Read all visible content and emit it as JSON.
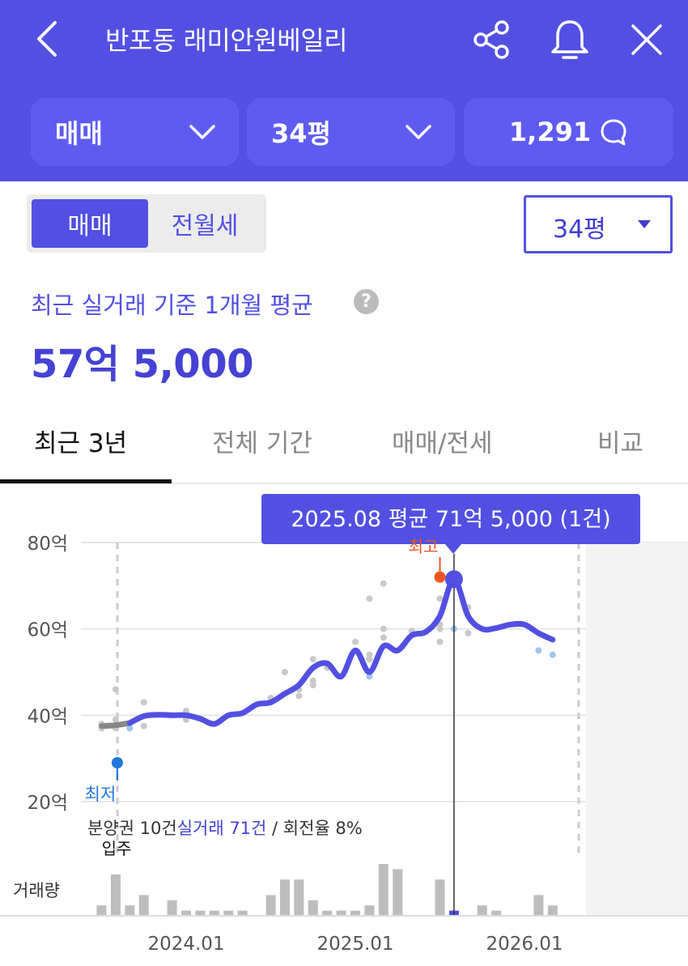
{
  "header": {
    "title": "반포동 래미안원베일리",
    "type_label": "매매",
    "size_label": "34평",
    "comment_count": "1,291",
    "icons": [
      "back-icon",
      "share-icon",
      "bell-icon",
      "close-icon",
      "chevron-down-icon",
      "comment-icon"
    ]
  },
  "controls": {
    "seg_sale": "매매",
    "seg_rent": "전월세",
    "size_select": "34평"
  },
  "summary": {
    "label": "최근 실거래 기준 1개월 평균",
    "value": "57억 5,000"
  },
  "tabs": [
    "최근 3년",
    "전체 기간",
    "매매/전세",
    "비교"
  ],
  "chart_annotations": {
    "tooltip": "2025.08 평균 71억 5,000 (1건)",
    "highest_label": "최고",
    "lowest_label": "최저",
    "move_in_label": "입주",
    "legend_presale": "분양권 10건",
    "legend_real": "실거래 71건",
    "legend_turnover": " / 회전율 8%",
    "volume_label": "거래량"
  },
  "colors": {
    "brand": "#5250e2",
    "line_prelim": "#888888",
    "high_marker": "#ee5522",
    "low_marker": "#2277dd",
    "volume_bar": "#bdbdbd"
  },
  "chart_data": {
    "type": "line",
    "y_unit": "억",
    "ylim": [
      20,
      80
    ],
    "y_ticks": [
      80,
      60,
      40,
      20
    ],
    "y_tick_labels": [
      "80억",
      "60억",
      "40억",
      "20억"
    ],
    "x_tick_labels": [
      "2024.01",
      "2025.01",
      "2026.01"
    ],
    "x_ticks": [
      "2024-01",
      "2025-01",
      "2026-01"
    ],
    "series": [
      {
        "role": "monthly average (presale period)",
        "points": [
          [
            "2023-07",
            37.5
          ],
          [
            "2023-08",
            37.7
          ],
          [
            "2023-09",
            38.2
          ]
        ]
      },
      {
        "role": "monthly average",
        "points": [
          [
            "2023-09",
            38.2
          ],
          [
            "2023-10",
            39.8
          ],
          [
            "2023-11",
            40.1
          ],
          [
            "2023-12",
            40.0
          ],
          [
            "2024-01",
            40.0
          ],
          [
            "2024-02",
            39.2
          ],
          [
            "2024-03",
            38.0
          ],
          [
            "2024-04",
            40.0
          ],
          [
            "2024-05",
            40.5
          ],
          [
            "2024-06",
            42.5
          ],
          [
            "2024-07",
            43.0
          ],
          [
            "2024-08",
            45.0
          ],
          [
            "2024-09",
            47.0
          ],
          [
            "2024-10",
            51.0
          ],
          [
            "2024-11",
            52.0
          ],
          [
            "2024-12",
            49.0
          ],
          [
            "2025-01",
            55.0
          ],
          [
            "2025-02",
            50.0
          ],
          [
            "2025-03",
            56.0
          ],
          [
            "2025-04",
            55.0
          ],
          [
            "2025-05",
            58.5
          ],
          [
            "2025-06",
            59.3
          ],
          [
            "2025-07",
            63.0
          ],
          [
            "2025-08",
            71.5
          ],
          [
            "2025-09",
            63.0
          ],
          [
            "2025-10",
            60.0
          ],
          [
            "2025-11",
            60.2
          ],
          [
            "2025-12",
            61.0
          ],
          [
            "2026-01",
            61.0
          ],
          [
            "2026-02",
            59.0
          ],
          [
            "2026-03",
            57.5
          ]
        ]
      }
    ],
    "scatter": [
      [
        "2023-07",
        38
      ],
      [
        "2023-07",
        37
      ],
      [
        "2023-08",
        46
      ],
      [
        "2023-08",
        39
      ],
      [
        "2023-08",
        37
      ],
      [
        "2023-09",
        37
      ],
      [
        "2023-10",
        43
      ],
      [
        "2023-10",
        37.5
      ],
      [
        "2024-01",
        41
      ],
      [
        "2024-01",
        39
      ],
      [
        "2024-07",
        43
      ],
      [
        "2024-07",
        44
      ],
      [
        "2024-08",
        50
      ],
      [
        "2024-09",
        44.5
      ],
      [
        "2024-09",
        46
      ],
      [
        "2024-10",
        53
      ],
      [
        "2024-10",
        48
      ],
      [
        "2024-10",
        47
      ],
      [
        "2024-11",
        51
      ],
      [
        "2024-12",
        49
      ],
      [
        "2025-01",
        57
      ],
      [
        "2025-02",
        54
      ],
      [
        "2025-02",
        53
      ],
      [
        "2025-02",
        49
      ],
      [
        "2025-02",
        67
      ],
      [
        "2025-03",
        70.5
      ],
      [
        "2025-03",
        58
      ],
      [
        "2025-03",
        60
      ],
      [
        "2025-05",
        59.5
      ],
      [
        "2025-07",
        67
      ],
      [
        "2025-07",
        61
      ],
      [
        "2025-07",
        60
      ],
      [
        "2025-07",
        57
      ],
      [
        "2025-08",
        60
      ],
      [
        "2025-09",
        65
      ],
      [
        "2025-09",
        59
      ],
      [
        "2026-02",
        55
      ],
      [
        "2026-03",
        54
      ]
    ],
    "highest": [
      "2025-07",
      72
    ],
    "lowest": [
      "2023-08",
      29
    ],
    "volume_max": 10,
    "volume": [
      [
        "2023-07",
        2
      ],
      [
        "2023-08",
        8
      ],
      [
        "2023-09",
        2
      ],
      [
        "2023-10",
        4
      ],
      [
        "2023-12",
        3
      ],
      [
        "2024-01",
        1
      ],
      [
        "2024-02",
        1
      ],
      [
        "2024-03",
        1
      ],
      [
        "2024-04",
        1
      ],
      [
        "2024-05",
        1
      ],
      [
        "2024-07",
        4
      ],
      [
        "2024-08",
        7
      ],
      [
        "2024-09",
        7
      ],
      [
        "2024-10",
        3
      ],
      [
        "2024-11",
        1
      ],
      [
        "2024-12",
        1
      ],
      [
        "2025-01",
        1
      ],
      [
        "2025-02",
        2
      ],
      [
        "2025-03",
        10
      ],
      [
        "2025-04",
        9
      ],
      [
        "2025-07",
        7
      ],
      [
        "2025-08",
        1
      ],
      [
        "2025-10",
        2
      ],
      [
        "2025-11",
        1
      ],
      [
        "2026-02",
        4
      ],
      [
        "2026-03",
        2
      ]
    ],
    "highlight_month": "2025-08",
    "grid": true
  }
}
